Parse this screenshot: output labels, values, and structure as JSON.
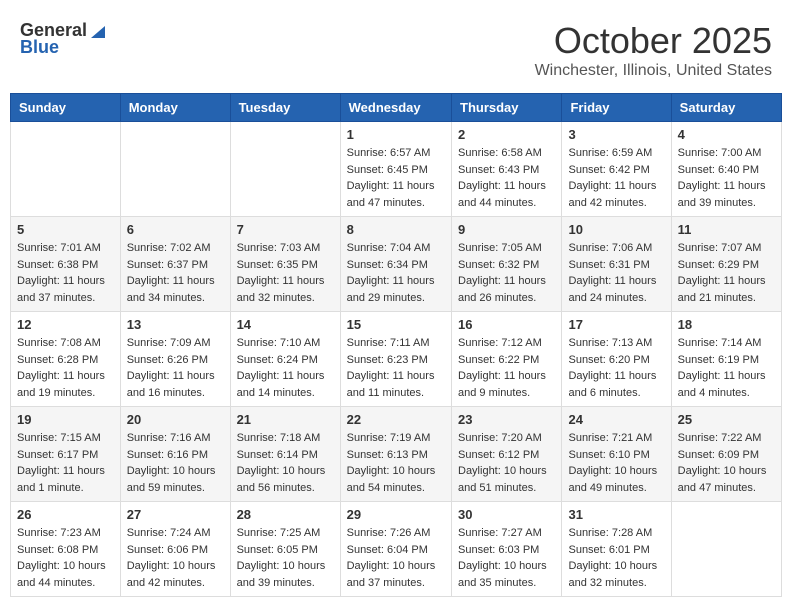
{
  "header": {
    "logo_general": "General",
    "logo_blue": "Blue",
    "month": "October 2025",
    "location": "Winchester, Illinois, United States"
  },
  "calendar": {
    "days_of_week": [
      "Sunday",
      "Monday",
      "Tuesday",
      "Wednesday",
      "Thursday",
      "Friday",
      "Saturday"
    ],
    "weeks": [
      [
        {
          "day": "",
          "info": ""
        },
        {
          "day": "",
          "info": ""
        },
        {
          "day": "",
          "info": ""
        },
        {
          "day": "1",
          "info": "Sunrise: 6:57 AM\nSunset: 6:45 PM\nDaylight: 11 hours\nand 47 minutes."
        },
        {
          "day": "2",
          "info": "Sunrise: 6:58 AM\nSunset: 6:43 PM\nDaylight: 11 hours\nand 44 minutes."
        },
        {
          "day": "3",
          "info": "Sunrise: 6:59 AM\nSunset: 6:42 PM\nDaylight: 11 hours\nand 42 minutes."
        },
        {
          "day": "4",
          "info": "Sunrise: 7:00 AM\nSunset: 6:40 PM\nDaylight: 11 hours\nand 39 minutes."
        }
      ],
      [
        {
          "day": "5",
          "info": "Sunrise: 7:01 AM\nSunset: 6:38 PM\nDaylight: 11 hours\nand 37 minutes."
        },
        {
          "day": "6",
          "info": "Sunrise: 7:02 AM\nSunset: 6:37 PM\nDaylight: 11 hours\nand 34 minutes."
        },
        {
          "day": "7",
          "info": "Sunrise: 7:03 AM\nSunset: 6:35 PM\nDaylight: 11 hours\nand 32 minutes."
        },
        {
          "day": "8",
          "info": "Sunrise: 7:04 AM\nSunset: 6:34 PM\nDaylight: 11 hours\nand 29 minutes."
        },
        {
          "day": "9",
          "info": "Sunrise: 7:05 AM\nSunset: 6:32 PM\nDaylight: 11 hours\nand 26 minutes."
        },
        {
          "day": "10",
          "info": "Sunrise: 7:06 AM\nSunset: 6:31 PM\nDaylight: 11 hours\nand 24 minutes."
        },
        {
          "day": "11",
          "info": "Sunrise: 7:07 AM\nSunset: 6:29 PM\nDaylight: 11 hours\nand 21 minutes."
        }
      ],
      [
        {
          "day": "12",
          "info": "Sunrise: 7:08 AM\nSunset: 6:28 PM\nDaylight: 11 hours\nand 19 minutes."
        },
        {
          "day": "13",
          "info": "Sunrise: 7:09 AM\nSunset: 6:26 PM\nDaylight: 11 hours\nand 16 minutes."
        },
        {
          "day": "14",
          "info": "Sunrise: 7:10 AM\nSunset: 6:24 PM\nDaylight: 11 hours\nand 14 minutes."
        },
        {
          "day": "15",
          "info": "Sunrise: 7:11 AM\nSunset: 6:23 PM\nDaylight: 11 hours\nand 11 minutes."
        },
        {
          "day": "16",
          "info": "Sunrise: 7:12 AM\nSunset: 6:22 PM\nDaylight: 11 hours\nand 9 minutes."
        },
        {
          "day": "17",
          "info": "Sunrise: 7:13 AM\nSunset: 6:20 PM\nDaylight: 11 hours\nand 6 minutes."
        },
        {
          "day": "18",
          "info": "Sunrise: 7:14 AM\nSunset: 6:19 PM\nDaylight: 11 hours\nand 4 minutes."
        }
      ],
      [
        {
          "day": "19",
          "info": "Sunrise: 7:15 AM\nSunset: 6:17 PM\nDaylight: 11 hours\nand 1 minute."
        },
        {
          "day": "20",
          "info": "Sunrise: 7:16 AM\nSunset: 6:16 PM\nDaylight: 10 hours\nand 59 minutes."
        },
        {
          "day": "21",
          "info": "Sunrise: 7:18 AM\nSunset: 6:14 PM\nDaylight: 10 hours\nand 56 minutes."
        },
        {
          "day": "22",
          "info": "Sunrise: 7:19 AM\nSunset: 6:13 PM\nDaylight: 10 hours\nand 54 minutes."
        },
        {
          "day": "23",
          "info": "Sunrise: 7:20 AM\nSunset: 6:12 PM\nDaylight: 10 hours\nand 51 minutes."
        },
        {
          "day": "24",
          "info": "Sunrise: 7:21 AM\nSunset: 6:10 PM\nDaylight: 10 hours\nand 49 minutes."
        },
        {
          "day": "25",
          "info": "Sunrise: 7:22 AM\nSunset: 6:09 PM\nDaylight: 10 hours\nand 47 minutes."
        }
      ],
      [
        {
          "day": "26",
          "info": "Sunrise: 7:23 AM\nSunset: 6:08 PM\nDaylight: 10 hours\nand 44 minutes."
        },
        {
          "day": "27",
          "info": "Sunrise: 7:24 AM\nSunset: 6:06 PM\nDaylight: 10 hours\nand 42 minutes."
        },
        {
          "day": "28",
          "info": "Sunrise: 7:25 AM\nSunset: 6:05 PM\nDaylight: 10 hours\nand 39 minutes."
        },
        {
          "day": "29",
          "info": "Sunrise: 7:26 AM\nSunset: 6:04 PM\nDaylight: 10 hours\nand 37 minutes."
        },
        {
          "day": "30",
          "info": "Sunrise: 7:27 AM\nSunset: 6:03 PM\nDaylight: 10 hours\nand 35 minutes."
        },
        {
          "day": "31",
          "info": "Sunrise: 7:28 AM\nSunset: 6:01 PM\nDaylight: 10 hours\nand 32 minutes."
        },
        {
          "day": "",
          "info": ""
        }
      ]
    ]
  }
}
